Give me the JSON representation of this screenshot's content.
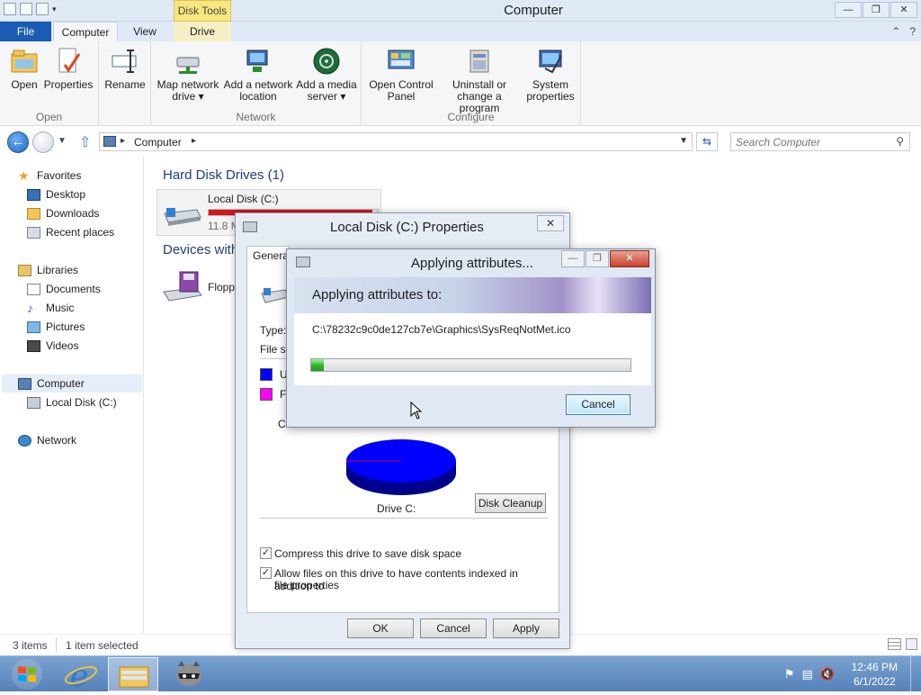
{
  "window": {
    "title": "Computer",
    "contextual_tab_group": "Disk Tools",
    "buttons": {
      "minimize": "—",
      "maximize": "❐",
      "close": "✕"
    }
  },
  "ribbon": {
    "tabs": {
      "file": "File",
      "computer": "Computer",
      "view": "View",
      "drive": "Drive"
    },
    "groups": {
      "open": {
        "label": "Open",
        "buttons": [
          "Open",
          "Properties"
        ]
      },
      "rename": {
        "buttons": [
          "Rename"
        ]
      },
      "network": {
        "label": "Network",
        "buttons": [
          {
            "line1": "Map network",
            "line2": "drive ▾"
          },
          {
            "line1": "Add a network",
            "line2": "location"
          },
          {
            "line1": "Add a media",
            "line2": "server ▾"
          }
        ]
      },
      "configure": {
        "label": "Configure",
        "buttons": [
          {
            "line1": "Open Control",
            "line2": "Panel"
          },
          {
            "line1": "Uninstall or",
            "line2": "change a program"
          },
          {
            "line1": "System",
            "line2": "properties"
          }
        ]
      }
    }
  },
  "address": {
    "crumb": "Computer",
    "search_placeholder": "Search Computer"
  },
  "nav": {
    "favorites": "Favorites",
    "desktop": "Desktop",
    "downloads": "Downloads",
    "recent": "Recent places",
    "libraries": "Libraries",
    "documents": "Documents",
    "music": "Music",
    "pictures": "Pictures",
    "videos": "Videos",
    "computer": "Computer",
    "local_disk": "Local Disk (C:)",
    "network": "Network"
  },
  "content": {
    "hdd_group": "Hard Disk Drives (1)",
    "devices_group": "Devices with",
    "local_disk_name": "Local Disk (C:)",
    "local_disk_free": "11.8 M",
    "local_disk_usage": 0.97,
    "floppy_name": "Flopp"
  },
  "status": {
    "items": "3 items",
    "selected": "1 item selected"
  },
  "properties_dialog": {
    "title": "Local Disk (C:) Properties",
    "tab_general": "General",
    "type_label": "Type:",
    "fs_label": "File sy",
    "used_label": "U",
    "free_label": "Fr",
    "capacity_label": "C",
    "drive_label": "Drive C:",
    "disk_cleanup": "Disk Cleanup",
    "compress": "Compress this drive to save disk space",
    "index_line1": "Allow files on this drive to have contents indexed in addition to",
    "index_line2": "file properties",
    "ok": "OK",
    "cancel": "Cancel",
    "apply": "Apply",
    "used_color": "#0000ff",
    "free_color": "#ff00ff"
  },
  "apply_dialog": {
    "title": "Applying attributes...",
    "heading": "Applying attributes to:",
    "path": "C:\\78232c9c0de127cb7e\\Graphics\\SysReqNotMet.ico",
    "progress_fraction": 0.04,
    "cancel": "Cancel"
  },
  "taskbar": {
    "time": "12:46 PM",
    "date": "6/1/2022"
  }
}
